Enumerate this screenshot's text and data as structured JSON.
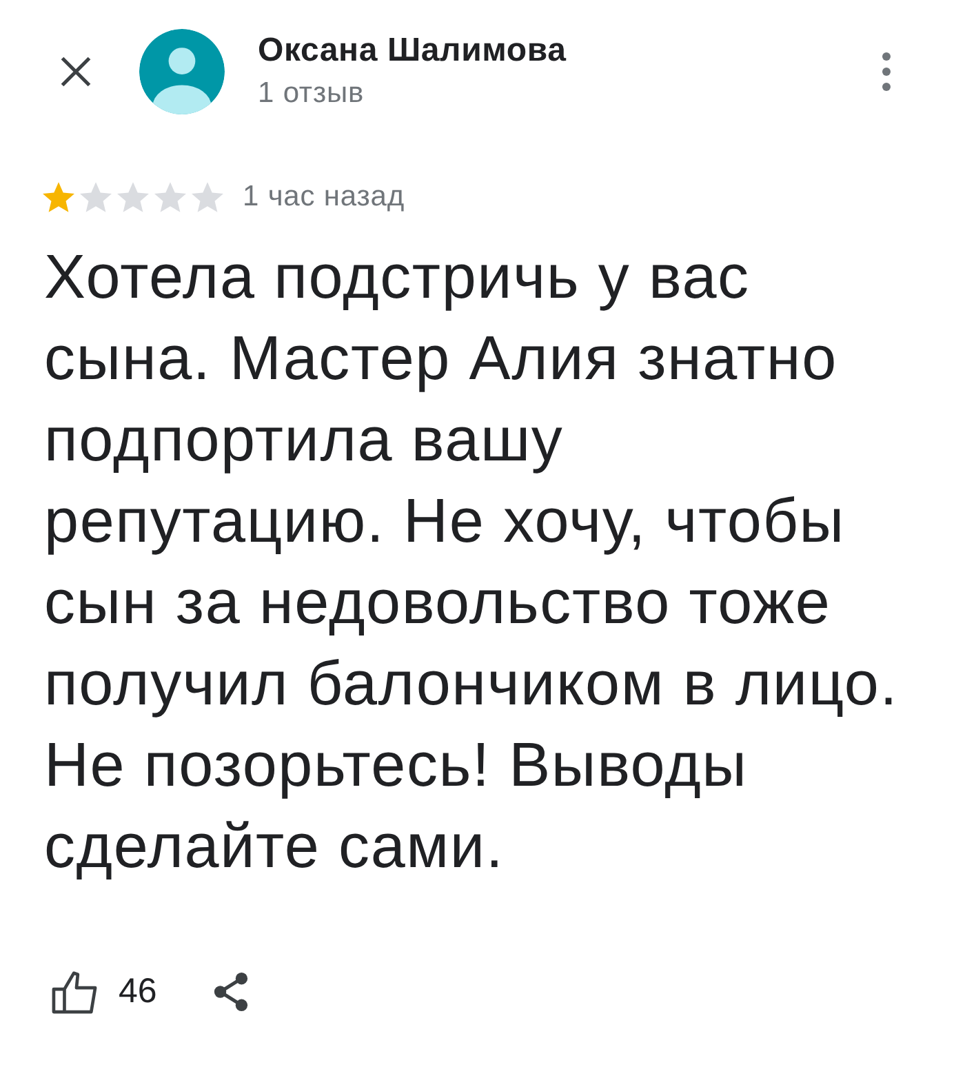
{
  "header": {
    "author": "Оксана Шалимова",
    "review_count": "1 отзыв"
  },
  "rating": {
    "stars": 1,
    "time": "1 час назад"
  },
  "review": {
    "text": "Хотела подстричь у вас сына. Мастер Алия знатно подпортила вашу репутацию. Не хочу, чтобы сын за недовольство тоже получил балончиком в лицо. Не позорьтесь! Выводы сделайте сами."
  },
  "actions": {
    "likes": "46"
  }
}
